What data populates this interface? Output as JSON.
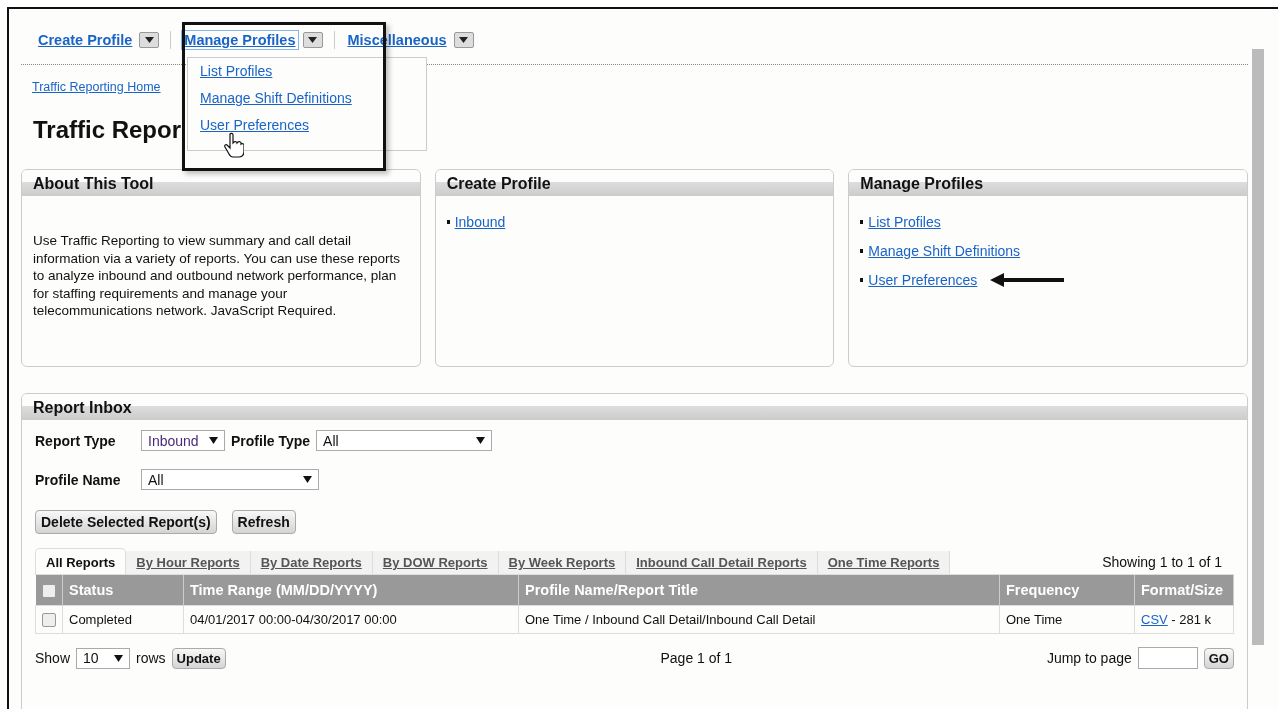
{
  "nav": [
    {
      "label": "Create Profile",
      "expanded": false
    },
    {
      "label": "Manage Profiles",
      "expanded": true
    },
    {
      "label": "Miscellaneous",
      "expanded": false
    }
  ],
  "dropdown": {
    "items": [
      "List Profiles",
      "Manage Shift Definitions",
      "User Preferences"
    ]
  },
  "breadcrumb": "Traffic Reporting Home",
  "page_title": "Traffic Repor",
  "panels": [
    {
      "title": "About This Tool",
      "kind": "text",
      "text": "Use Traffic Reporting to view summary and call detail information via a variety of reports. You can use these reports to analyze inbound and outbound network performance, plan for staffing requirements and manage your telecommunications network. JavaScript Required."
    },
    {
      "title": "Create Profile",
      "kind": "links",
      "links": [
        "Inbound"
      ]
    },
    {
      "title": "Manage Profiles",
      "kind": "links",
      "links": [
        "List Profiles",
        "Manage Shift Definitions",
        "User Preferences"
      ]
    }
  ],
  "inbox": {
    "title": "Report Inbox",
    "filters": [
      {
        "label": "Report Type",
        "value": "Inbound"
      },
      {
        "label": "Profile Type",
        "value": "All"
      },
      {
        "label": "Profile Name",
        "value": "All"
      }
    ],
    "buttons": [
      "Delete Selected Report(s)",
      "Refresh"
    ],
    "tabs": [
      {
        "label": "All Reports",
        "selected": true
      },
      {
        "label": "By Hour Reports",
        "selected": false
      },
      {
        "label": "By Date Reports",
        "selected": false
      },
      {
        "label": "By DOW Reports",
        "selected": false
      },
      {
        "label": "By Week Reports",
        "selected": false
      },
      {
        "label": "Inbound Call Detail Reports",
        "selected": false
      },
      {
        "label": "One Time Reports",
        "selected": false
      }
    ],
    "showing": "Showing 1 to 1 of 1",
    "table": {
      "header_checked": false,
      "columns": [
        "Status",
        "Time Range (MM/DD/YYYY)",
        "Profile Name/Report Title",
        "Frequency",
        "Format/Size"
      ],
      "rows": [
        {
          "checked": false,
          "status": "Completed",
          "time_range": "04/01/2017 00:00-04/30/2017 00:00",
          "title": "One Time / Inbound Call Detail/Inbound Call Detail",
          "frequency": "One Time",
          "format": "CSV",
          "size": "- 281 k"
        }
      ]
    },
    "pager": {
      "show_label": "Show",
      "rows_value": "10",
      "rows_label": "rows",
      "update": "Update",
      "page_text": "Page 1 of 1",
      "jump_label": "Jump to page",
      "go": "GO"
    }
  }
}
